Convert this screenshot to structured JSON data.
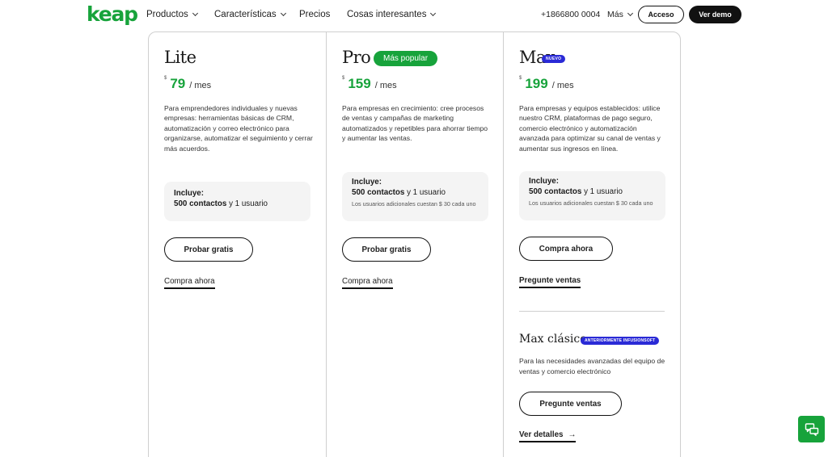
{
  "header": {
    "logo": "keap",
    "nav": [
      {
        "label": "Productos",
        "has_dropdown": true
      },
      {
        "label": "Características",
        "has_dropdown": true
      },
      {
        "label": "Precios",
        "has_dropdown": false
      },
      {
        "label": "Cosas interesantes",
        "has_dropdown": true
      }
    ],
    "phone": "+1866800 0004",
    "more_label": "Más",
    "login_label": "Acceso",
    "demo_label": "Ver demo"
  },
  "plans": [
    {
      "name": "Lite",
      "currency": "$",
      "price": "79",
      "period": "/ mes",
      "description": "Para emprendedores individuales y nuevas empresas: herramientas básicas de CRM, automatización y correo electrónico para organizarse, automatizar el seguimiento y cerrar más acuerdos.",
      "includes_title": "Incluye:",
      "includes_contacts": "500 contactos",
      "includes_users": " y 1 usuario",
      "primary_button": "Probar gratis",
      "secondary_link": "Compra ahora"
    },
    {
      "name": "Pro",
      "badge": "Más popular",
      "currency": "$",
      "price": "159",
      "period": "/ mes",
      "description": "Para empresas en crecimiento: cree procesos de ventas y campañas de marketing automatizados y repetibles para ahorrar tiempo y aumentar las ventas.",
      "includes_title": "Incluye:",
      "includes_contacts": "500 contactos",
      "includes_users": " y 1 usuario",
      "includes_note": "Los usuarios adicionales cuestan $ 30 cada uno",
      "primary_button": "Probar gratis",
      "secondary_link": "Compra ahora"
    },
    {
      "name": "Max",
      "badge": "NUEVO",
      "currency": "$",
      "price": "199",
      "period": "/ mes",
      "description": "Para empresas y equipos establecidos: utilice nuestro CRM, plataformas de pago seguro, comercio electrónico y automatización avanzada para optimizar su canal de ventas y aumentar sus ingresos en línea.",
      "includes_title": "Incluye:",
      "includes_contacts": "500 contactos",
      "includes_users": " y 1 usuario",
      "includes_note": "Los usuarios adicionales cuestan $ 30 cada uno",
      "primary_button": "Compra ahora",
      "secondary_link": "Pregunte ventas"
    }
  ],
  "max_classic": {
    "name": "Max clásico",
    "badge": "ANTERIORMENTE INFUSIONSOFT",
    "description": "Para las necesidades avanzadas del equipo de ventas y comercio electrónico",
    "button": "Pregunte ventas",
    "link": "Ver detalles",
    "link_arrow": "→"
  },
  "colors": {
    "brand_green": "#17a33b",
    "badge_blue": "#2a2ad6",
    "text_dark": "#1a1a1a"
  },
  "icons": {
    "chat_widget": "chat-icon",
    "dropdown": "chevron-down-icon"
  }
}
